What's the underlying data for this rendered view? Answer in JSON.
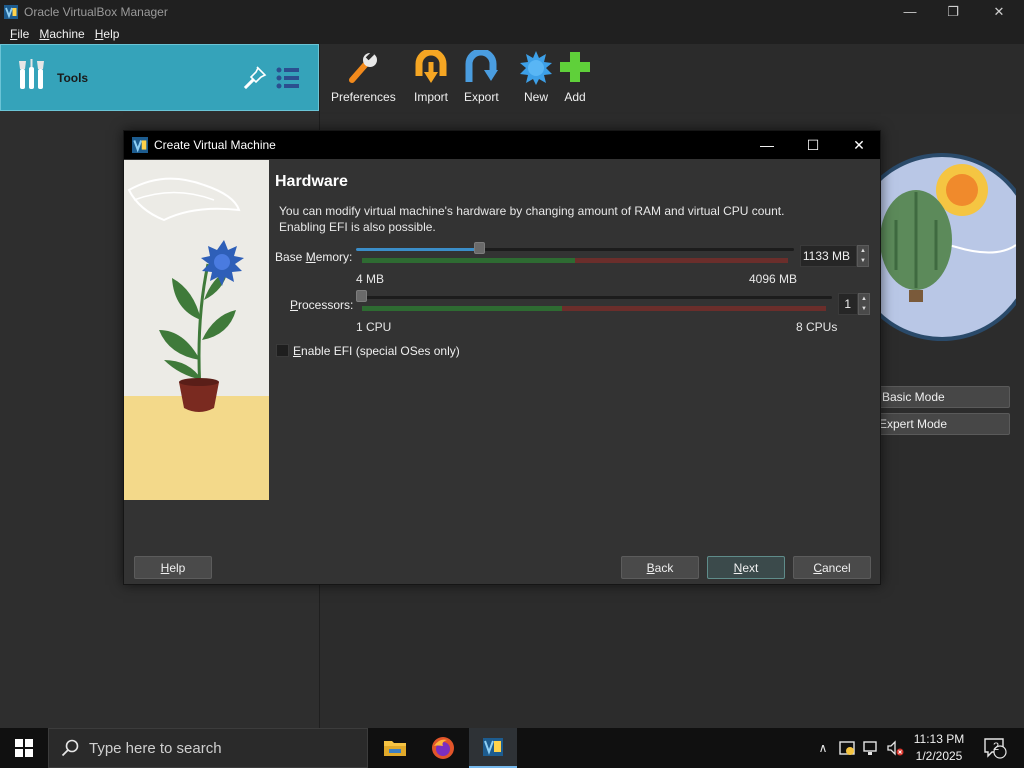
{
  "window": {
    "title": "Oracle VirtualBox Manager"
  },
  "menu": {
    "file": "File",
    "file_mn": "F",
    "file_rest": "ile",
    "machine": "Machine",
    "machine_mn": "M",
    "machine_rest": "achine",
    "help": "Help",
    "help_mn": "H",
    "help_rest": "elp"
  },
  "sidebar": {
    "tools_label": "Tools"
  },
  "toolbar": {
    "preferences": "Preferences",
    "import": "Import",
    "export": "Export",
    "new": "New",
    "add": "Add"
  },
  "details": {
    "basic_mode": "Basic Mode",
    "expert_mode": "Expert Mode"
  },
  "dialog": {
    "title": "Create Virtual Machine",
    "heading": "Hardware",
    "description_line1": "You can modify virtual machine's hardware by changing amount of RAM and virtual CPU count.",
    "description_line2": "Enabling EFI is also possible.",
    "memory": {
      "label_pre": "Base ",
      "label_mn": "M",
      "label_post": "emory:",
      "value": "1133 MB",
      "min_label": "4 MB",
      "max_label": "4096 MB",
      "fraction": 0.277
    },
    "processors": {
      "label_mn": "P",
      "label_post": "rocessors:",
      "value": "1",
      "min_label": "1 CPU",
      "max_label": "8 CPUs",
      "fraction": 0
    },
    "efi": {
      "label_mn": "E",
      "label_post": "nable EFI (special OSes only)",
      "checked": false
    },
    "buttons": {
      "help_mn": "H",
      "help_rest": "elp",
      "back_mn": "B",
      "back_rest": "ack",
      "next_mn": "N",
      "next_rest": "ext",
      "cancel_mn": "C",
      "cancel_rest": "ancel"
    }
  },
  "taskbar": {
    "search_placeholder": "Type here to search",
    "time": "11:13 PM",
    "date": "1/2/2025",
    "notifications_count": "2"
  },
  "colors": {
    "accent": "#35a3ba",
    "slider_fill": "#3b8ec9",
    "scale_green": "#2e6b32",
    "scale_red": "#6b2e2b"
  }
}
